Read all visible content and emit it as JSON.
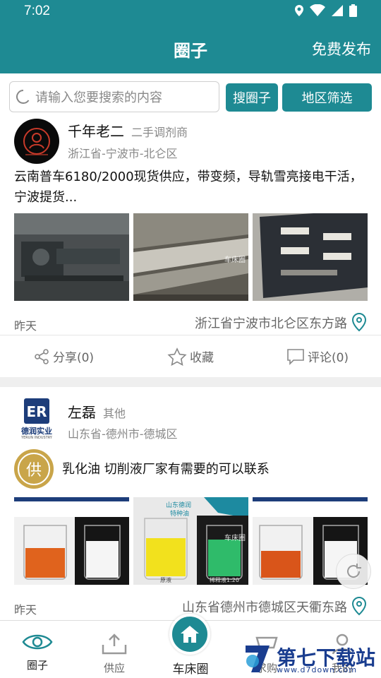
{
  "status": {
    "time": "7:02"
  },
  "header": {
    "title": "圈子",
    "publish": "免费发布"
  },
  "search": {
    "placeholder": "请输入您要搜索的内容",
    "search_btn": "搜圈子",
    "region_btn": "地区筛选"
  },
  "posts": [
    {
      "user": "千年老二",
      "tag": "二手调剂商",
      "location": "浙江省-宁波市-北仑区",
      "content": "云南普车6180/2000现货供应，带变频，导轨雪亮接电干活，宁波提货...",
      "watermark": "车床圈",
      "date": "昨天",
      "address": "浙江省宁波市北仑区东方路"
    },
    {
      "user": "左磊",
      "tag": "其他",
      "location": "山东省-德州市-德城区",
      "badge": "供",
      "logo_text": "德润实业",
      "logo_sub": "YERUN INDUSTRY",
      "content": "乳化油 切削液厂家有需要的可以联系",
      "photo_label_1": "山东德润",
      "photo_label_2": "特种油",
      "photo_caption_1": "原液",
      "photo_caption_2": "稀释液1:20",
      "watermark": "车床圈",
      "date": "昨天",
      "address": "山东省德州市德城区天衢东路"
    }
  ],
  "actions": {
    "share": "分享(0)",
    "collect": "收藏",
    "comment": "评论(0)"
  },
  "tabs": {
    "circle": "圈子",
    "supply": "供应",
    "home": "车床圈",
    "demand": "求购",
    "mine": "我的"
  },
  "site_watermark": {
    "text": "第七下载站",
    "url": "www.d7down.com"
  }
}
